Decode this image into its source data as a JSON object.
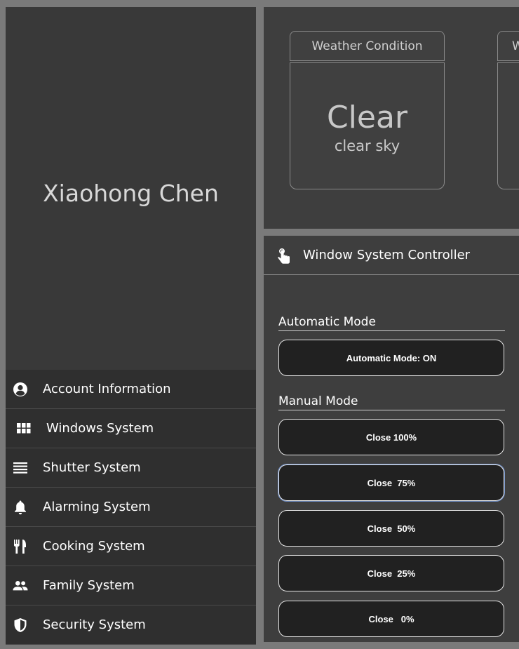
{
  "profile": {
    "name": "Xiaohong Chen"
  },
  "menu": [
    {
      "id": "account",
      "label": "Account Information",
      "icon": "account-circle-icon"
    },
    {
      "id": "windows",
      "label": "Windows System",
      "icon": "window-grid-icon"
    },
    {
      "id": "shutter",
      "label": "Shutter System",
      "icon": "shutter-lines-icon"
    },
    {
      "id": "alarm",
      "label": "Alarming System",
      "icon": "bell-icon"
    },
    {
      "id": "cooking",
      "label": "Cooking System",
      "icon": "fork-knife-icon"
    },
    {
      "id": "family",
      "label": "Family System",
      "icon": "people-icon"
    },
    {
      "id": "security",
      "label": "Security System",
      "icon": "shield-icon"
    }
  ],
  "weather": {
    "card_title": "Weather Condition",
    "main": "Clear",
    "description": "clear sky",
    "second_card_title_partial": "W"
  },
  "controller": {
    "icon": "touch-hand-icon",
    "title": "Window System Controller",
    "automatic": {
      "section_label": "Automatic Mode",
      "button_label": "Automatic Mode: ON"
    },
    "manual": {
      "section_label": "Manual Mode",
      "buttons": [
        "Close 100%",
        "Close  75%",
        "Close  50%",
        "Close  25%",
        "Close   0%"
      ]
    }
  },
  "colors": {
    "page_bg": "#7a7a7a",
    "sidebar_bg": "#393939",
    "menu_bg": "#2f2f2f",
    "panel_bg": "#3e3e3e",
    "button_bg": "#212121",
    "focus_outline": "#6f8fc8"
  }
}
